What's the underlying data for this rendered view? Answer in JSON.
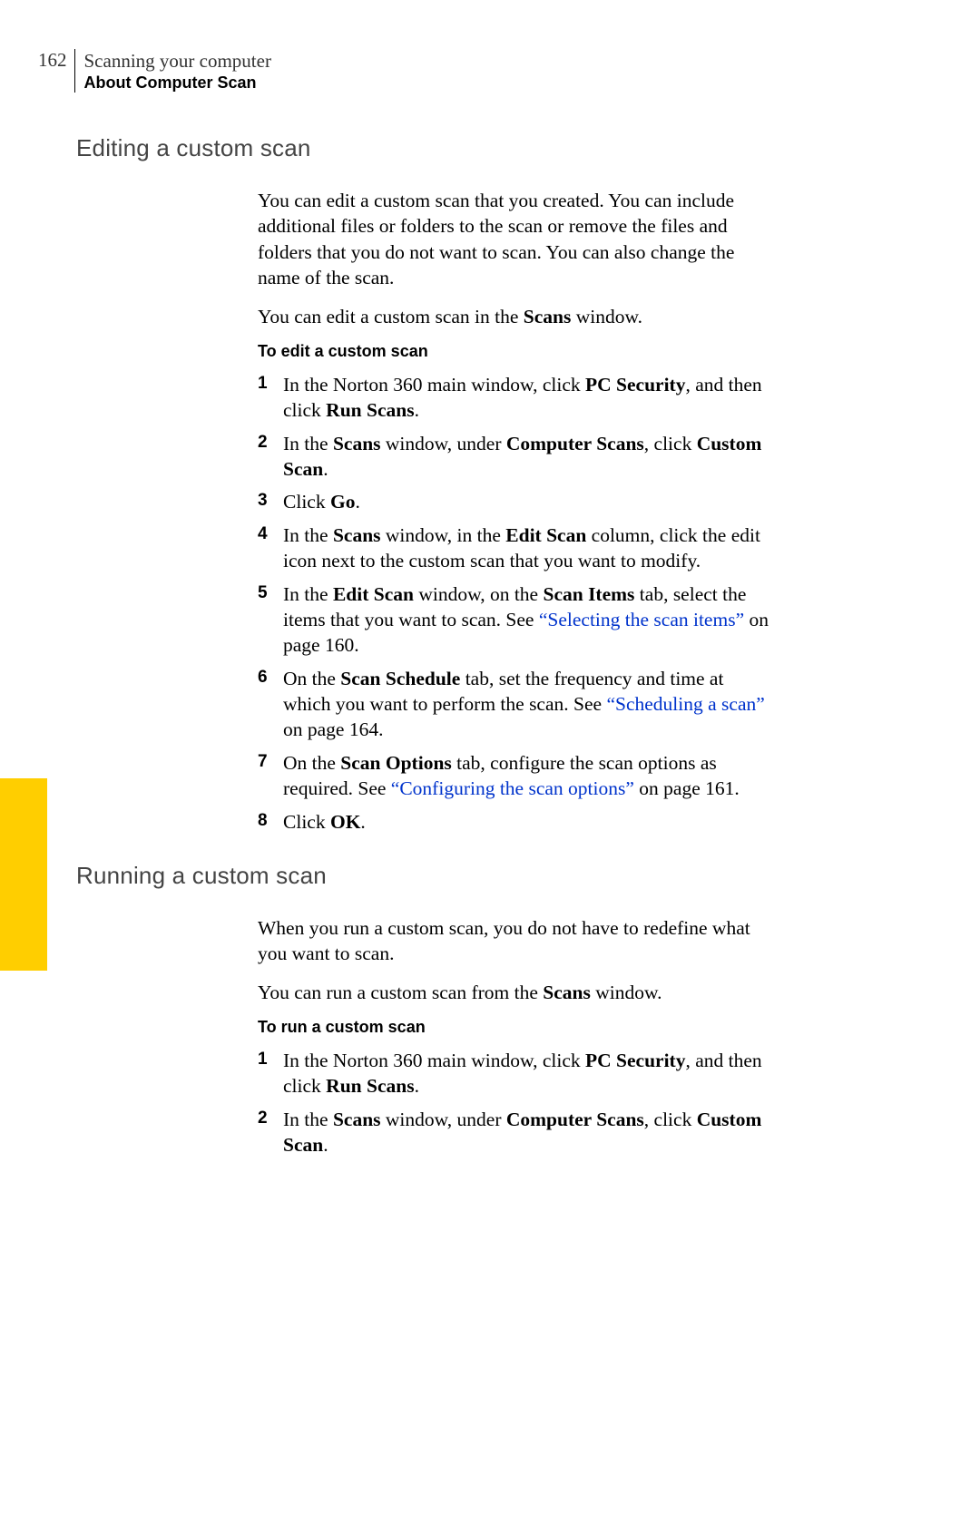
{
  "header": {
    "page_number": "162",
    "chapter": "Scanning your computer",
    "section": "About Computer Scan"
  },
  "section1": {
    "heading": "Editing a custom scan",
    "para1": "You can edit a custom scan that you created. You can include additional files or folders to the scan or remove the files and folders that you do not want to scan. You can also change the name of the scan.",
    "para2_pre": "You can edit a custom scan in the ",
    "para2_bold": "Scans",
    "para2_post": " window.",
    "task_heading": "To edit a custom scan",
    "steps": {
      "s1_a": "In the Norton 360 main window, click ",
      "s1_b1": "PC Security",
      "s1_c": ", and then click ",
      "s1_b2": "Run Scans",
      "s1_d": ".",
      "s2_a": "In the ",
      "s2_b1": "Scans",
      "s2_c": " window, under ",
      "s2_b2": "Computer Scans",
      "s2_d": ", click ",
      "s2_b3": "Custom Scan",
      "s2_e": ".",
      "s3_a": "Click ",
      "s3_b": "Go",
      "s3_c": ".",
      "s4_a": "In the ",
      "s4_b1": "Scans",
      "s4_c": " window, in the ",
      "s4_b2": "Edit Scan",
      "s4_d": " column, click the edit icon next to the custom scan that you want to modify.",
      "s5_a": "In the ",
      "s5_b1": "Edit Scan",
      "s5_c": " window, on the ",
      "s5_b2": "Scan Items",
      "s5_d": " tab, select the items that you want to scan. See ",
      "s5_link": "“Selecting the scan items”",
      "s5_e": " on page 160.",
      "s6_a": "On the ",
      "s6_b": "Scan Schedule",
      "s6_c": " tab, set the frequency and time at which you want to perform the scan. See ",
      "s6_link": "“Scheduling a scan”",
      "s6_d": " on page 164.",
      "s7_a": "On the ",
      "s7_b": "Scan Options",
      "s7_c": " tab, configure the scan options as required. See ",
      "s7_link": "“Configuring the scan options”",
      "s7_d": " on page 161.",
      "s8_a": "Click ",
      "s8_b": "OK",
      "s8_c": "."
    }
  },
  "section2": {
    "heading": "Running a custom scan",
    "para1": "When you run a custom scan, you do not have to redefine what you want to scan.",
    "para2_pre": "You can run a custom scan from the ",
    "para2_bold": "Scans",
    "para2_post": " window.",
    "task_heading": "To run a custom scan",
    "steps": {
      "s1_a": "In the Norton 360 main window, click ",
      "s1_b1": "PC Security",
      "s1_c": ", and then click ",
      "s1_b2": "Run Scans",
      "s1_d": ".",
      "s2_a": "In the ",
      "s2_b1": "Scans",
      "s2_c": " window, under ",
      "s2_b2": "Computer Scans",
      "s2_d": ", click ",
      "s2_b3": "Custom Scan",
      "s2_e": "."
    }
  }
}
